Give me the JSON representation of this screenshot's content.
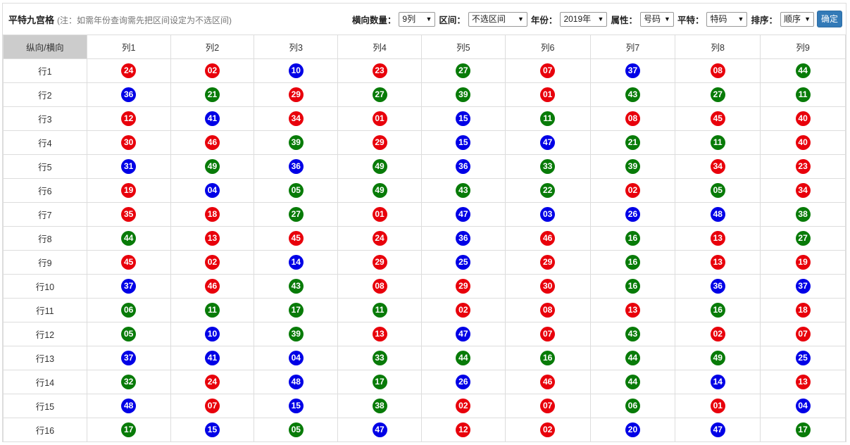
{
  "header": {
    "title": "平特九宫格",
    "note": "(注：如需年份查询需先把区间设定为不选区间)"
  },
  "filters": [
    {
      "label": "横向数量：",
      "value": "9列"
    },
    {
      "label": "区间：",
      "value": "不选区间"
    },
    {
      "label": "年份：",
      "value": "2019年"
    },
    {
      "label": "属性：",
      "value": "号码"
    },
    {
      "label": "平特：",
      "value": "特码"
    },
    {
      "label": "排序：",
      "value": "顺序"
    }
  ],
  "confirm_label": "确定",
  "colors": {
    "red": "#e8000b",
    "blue": "#0000e6",
    "green": "#087b08"
  },
  "grid": {
    "corner": "纵向/横向",
    "columns": [
      "列1",
      "列2",
      "列3",
      "列4",
      "列5",
      "列6",
      "列7",
      "列8",
      "列9"
    ],
    "rows": [
      {
        "label": "行1",
        "cells": [
          {
            "n": "24",
            "c": "red"
          },
          {
            "n": "02",
            "c": "red"
          },
          {
            "n": "10",
            "c": "blue"
          },
          {
            "n": "23",
            "c": "red"
          },
          {
            "n": "27",
            "c": "green"
          },
          {
            "n": "07",
            "c": "red"
          },
          {
            "n": "37",
            "c": "blue"
          },
          {
            "n": "08",
            "c": "red"
          },
          {
            "n": "44",
            "c": "green"
          }
        ]
      },
      {
        "label": "行2",
        "cells": [
          {
            "n": "36",
            "c": "blue"
          },
          {
            "n": "21",
            "c": "green"
          },
          {
            "n": "29",
            "c": "red"
          },
          {
            "n": "27",
            "c": "green"
          },
          {
            "n": "39",
            "c": "green"
          },
          {
            "n": "01",
            "c": "red"
          },
          {
            "n": "43",
            "c": "green"
          },
          {
            "n": "27",
            "c": "green"
          },
          {
            "n": "11",
            "c": "green"
          }
        ]
      },
      {
        "label": "行3",
        "cells": [
          {
            "n": "12",
            "c": "red"
          },
          {
            "n": "41",
            "c": "blue"
          },
          {
            "n": "34",
            "c": "red"
          },
          {
            "n": "01",
            "c": "red"
          },
          {
            "n": "15",
            "c": "blue"
          },
          {
            "n": "11",
            "c": "green"
          },
          {
            "n": "08",
            "c": "red"
          },
          {
            "n": "45",
            "c": "red"
          },
          {
            "n": "40",
            "c": "red"
          }
        ]
      },
      {
        "label": "行4",
        "cells": [
          {
            "n": "30",
            "c": "red"
          },
          {
            "n": "46",
            "c": "red"
          },
          {
            "n": "39",
            "c": "green"
          },
          {
            "n": "29",
            "c": "red"
          },
          {
            "n": "15",
            "c": "blue"
          },
          {
            "n": "47",
            "c": "blue"
          },
          {
            "n": "21",
            "c": "green"
          },
          {
            "n": "11",
            "c": "green"
          },
          {
            "n": "40",
            "c": "red"
          }
        ]
      },
      {
        "label": "行5",
        "cells": [
          {
            "n": "31",
            "c": "blue"
          },
          {
            "n": "49",
            "c": "green"
          },
          {
            "n": "36",
            "c": "blue"
          },
          {
            "n": "49",
            "c": "green"
          },
          {
            "n": "36",
            "c": "blue"
          },
          {
            "n": "33",
            "c": "green"
          },
          {
            "n": "39",
            "c": "green"
          },
          {
            "n": "34",
            "c": "red"
          },
          {
            "n": "23",
            "c": "red"
          }
        ]
      },
      {
        "label": "行6",
        "cells": [
          {
            "n": "19",
            "c": "red"
          },
          {
            "n": "04",
            "c": "blue"
          },
          {
            "n": "05",
            "c": "green"
          },
          {
            "n": "49",
            "c": "green"
          },
          {
            "n": "43",
            "c": "green"
          },
          {
            "n": "22",
            "c": "green"
          },
          {
            "n": "02",
            "c": "red"
          },
          {
            "n": "05",
            "c": "green"
          },
          {
            "n": "34",
            "c": "red"
          }
        ]
      },
      {
        "label": "行7",
        "cells": [
          {
            "n": "35",
            "c": "red"
          },
          {
            "n": "18",
            "c": "red"
          },
          {
            "n": "27",
            "c": "green"
          },
          {
            "n": "01",
            "c": "red"
          },
          {
            "n": "47",
            "c": "blue"
          },
          {
            "n": "03",
            "c": "blue"
          },
          {
            "n": "26",
            "c": "blue"
          },
          {
            "n": "48",
            "c": "blue"
          },
          {
            "n": "38",
            "c": "green"
          }
        ]
      },
      {
        "label": "行8",
        "cells": [
          {
            "n": "44",
            "c": "green"
          },
          {
            "n": "13",
            "c": "red"
          },
          {
            "n": "45",
            "c": "red"
          },
          {
            "n": "24",
            "c": "red"
          },
          {
            "n": "36",
            "c": "blue"
          },
          {
            "n": "46",
            "c": "red"
          },
          {
            "n": "16",
            "c": "green"
          },
          {
            "n": "13",
            "c": "red"
          },
          {
            "n": "27",
            "c": "green"
          }
        ]
      },
      {
        "label": "行9",
        "cells": [
          {
            "n": "45",
            "c": "red"
          },
          {
            "n": "02",
            "c": "red"
          },
          {
            "n": "14",
            "c": "blue"
          },
          {
            "n": "29",
            "c": "red"
          },
          {
            "n": "25",
            "c": "blue"
          },
          {
            "n": "29",
            "c": "red"
          },
          {
            "n": "16",
            "c": "green"
          },
          {
            "n": "13",
            "c": "red"
          },
          {
            "n": "19",
            "c": "red"
          }
        ]
      },
      {
        "label": "行10",
        "cells": [
          {
            "n": "37",
            "c": "blue"
          },
          {
            "n": "46",
            "c": "red"
          },
          {
            "n": "43",
            "c": "green"
          },
          {
            "n": "08",
            "c": "red"
          },
          {
            "n": "29",
            "c": "red"
          },
          {
            "n": "30",
            "c": "red"
          },
          {
            "n": "16",
            "c": "green"
          },
          {
            "n": "36",
            "c": "blue"
          },
          {
            "n": "37",
            "c": "blue"
          }
        ]
      },
      {
        "label": "行11",
        "cells": [
          {
            "n": "06",
            "c": "green"
          },
          {
            "n": "11",
            "c": "green"
          },
          {
            "n": "17",
            "c": "green"
          },
          {
            "n": "11",
            "c": "green"
          },
          {
            "n": "02",
            "c": "red"
          },
          {
            "n": "08",
            "c": "red"
          },
          {
            "n": "13",
            "c": "red"
          },
          {
            "n": "16",
            "c": "green"
          },
          {
            "n": "18",
            "c": "red"
          }
        ]
      },
      {
        "label": "行12",
        "cells": [
          {
            "n": "05",
            "c": "green"
          },
          {
            "n": "10",
            "c": "blue"
          },
          {
            "n": "39",
            "c": "green"
          },
          {
            "n": "13",
            "c": "red"
          },
          {
            "n": "47",
            "c": "blue"
          },
          {
            "n": "07",
            "c": "red"
          },
          {
            "n": "43",
            "c": "green"
          },
          {
            "n": "02",
            "c": "red"
          },
          {
            "n": "07",
            "c": "red"
          }
        ]
      },
      {
        "label": "行13",
        "cells": [
          {
            "n": "37",
            "c": "blue"
          },
          {
            "n": "41",
            "c": "blue"
          },
          {
            "n": "04",
            "c": "blue"
          },
          {
            "n": "33",
            "c": "green"
          },
          {
            "n": "44",
            "c": "green"
          },
          {
            "n": "16",
            "c": "green"
          },
          {
            "n": "44",
            "c": "green"
          },
          {
            "n": "49",
            "c": "green"
          },
          {
            "n": "25",
            "c": "blue"
          }
        ]
      },
      {
        "label": "行14",
        "cells": [
          {
            "n": "32",
            "c": "green"
          },
          {
            "n": "24",
            "c": "red"
          },
          {
            "n": "48",
            "c": "blue"
          },
          {
            "n": "17",
            "c": "green"
          },
          {
            "n": "26",
            "c": "blue"
          },
          {
            "n": "46",
            "c": "red"
          },
          {
            "n": "44",
            "c": "green"
          },
          {
            "n": "14",
            "c": "blue"
          },
          {
            "n": "13",
            "c": "red"
          }
        ]
      },
      {
        "label": "行15",
        "cells": [
          {
            "n": "48",
            "c": "blue"
          },
          {
            "n": "07",
            "c": "red"
          },
          {
            "n": "15",
            "c": "blue"
          },
          {
            "n": "38",
            "c": "green"
          },
          {
            "n": "02",
            "c": "red"
          },
          {
            "n": "07",
            "c": "red"
          },
          {
            "n": "06",
            "c": "green"
          },
          {
            "n": "01",
            "c": "red"
          },
          {
            "n": "04",
            "c": "blue"
          }
        ]
      },
      {
        "label": "行16",
        "cells": [
          {
            "n": "17",
            "c": "green"
          },
          {
            "n": "15",
            "c": "blue"
          },
          {
            "n": "05",
            "c": "green"
          },
          {
            "n": "47",
            "c": "blue"
          },
          {
            "n": "12",
            "c": "red"
          },
          {
            "n": "02",
            "c": "red"
          },
          {
            "n": "20",
            "c": "blue"
          },
          {
            "n": "47",
            "c": "blue"
          },
          {
            "n": "17",
            "c": "green"
          }
        ]
      }
    ]
  }
}
